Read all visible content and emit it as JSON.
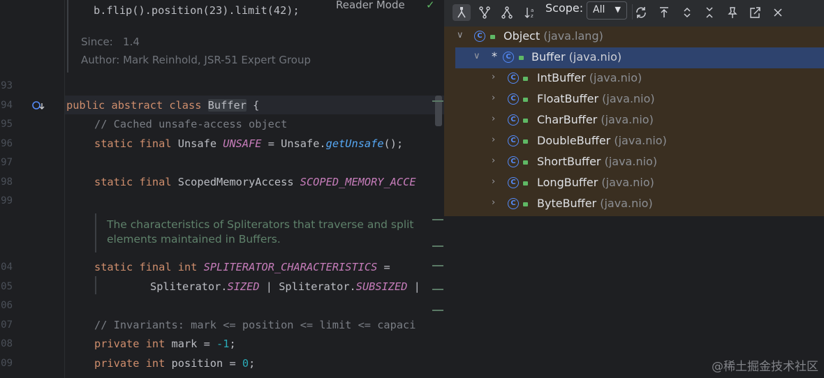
{
  "editor": {
    "top_code": "b.flip().position(23).limit(42);",
    "reader_mode": "Reader Mode",
    "doc_since_label": "Since:",
    "doc_since_value": "1.4",
    "doc_author_label": "Author:",
    "doc_author_value": "Mark Reinhold, JSR-51 Expert Group",
    "line_numbers": [
      "93",
      "94",
      "95",
      "96",
      "97",
      "98",
      "99",
      "04",
      "05",
      "06",
      "07",
      "08",
      "09"
    ],
    "class_decl": {
      "kw1": "public",
      "kw2": "abstract",
      "kw3": "class",
      "name": "Buffer",
      "brace": "{"
    },
    "comment_unsafe": "// Cached unsafe-access object",
    "unsafe_line": {
      "kw1": "static",
      "kw2": "final",
      "type": "Unsafe",
      "field": "UNSAFE",
      "eq": "=",
      "call_recv": "Unsafe.",
      "call_method": "getUnsafe",
      "call_end": "();"
    },
    "scoped_line": {
      "kw1": "static",
      "kw2": "final",
      "type": "ScopedMemoryAccess",
      "field": "SCOPED_MEMORY_ACCE"
    },
    "docblock": [
      "The characteristics of Spliterators that traverse and split",
      "elements maintained in Buffers."
    ],
    "spliterator_line": {
      "kw1": "static",
      "kw2": "final",
      "kw3": "int",
      "field": "SPLITERATOR_CHARACTERISTICS",
      "eq": "="
    },
    "spliterator_cont": {
      "p1": "Spliterator.",
      "f1": "SIZED",
      "sep": " | ",
      "p2": "Spliterator.",
      "f2": "SUBSIZED",
      "tail": " |"
    },
    "comment_invariants": "// Invariants: mark <= position <= limit <= capaci",
    "mark_line": {
      "kw1": "private",
      "kw2": "int",
      "name": "mark",
      "eq": "=",
      "val": "-1",
      "end": ";"
    },
    "position_line": {
      "kw1": "private",
      "kw2": "int",
      "name": "position",
      "eq": "=",
      "val": "0",
      "end": ";"
    }
  },
  "hierarchy": {
    "scope_label": "Scope:",
    "scope_value": "All",
    "toolbar_icons": [
      "subtypes-hierarchy-icon",
      "supertypes-hierarchy-icon",
      "class-hierarchy-icon",
      "sort-alpha-icon",
      "refresh-icon",
      "scroll-to-top-icon",
      "expand-all-icon",
      "collapse-all-icon",
      "pin-icon",
      "open-in-window-icon",
      "close-icon"
    ],
    "tree": [
      {
        "name": "Object",
        "pkg": "(java.lang)",
        "level": 0,
        "expanded": true
      },
      {
        "name": "Buffer",
        "pkg": "(java.nio)",
        "level": 1,
        "expanded": true,
        "selected": true,
        "star": "*"
      },
      {
        "name": "IntBuffer",
        "pkg": "(java.nio)",
        "level": 2
      },
      {
        "name": "FloatBuffer",
        "pkg": "(java.nio)",
        "level": 2
      },
      {
        "name": "CharBuffer",
        "pkg": "(java.nio)",
        "level": 2
      },
      {
        "name": "DoubleBuffer",
        "pkg": "(java.nio)",
        "level": 2
      },
      {
        "name": "ShortBuffer",
        "pkg": "(java.nio)",
        "level": 2
      },
      {
        "name": "LongBuffer",
        "pkg": "(java.nio)",
        "level": 2
      },
      {
        "name": "ByteBuffer",
        "pkg": "(java.nio)",
        "level": 2
      }
    ]
  },
  "watermark": "@稀土掘金技术社区",
  "colors": {
    "keyword": "#cf8e6d",
    "static_field": "#c77dbb",
    "number": "#2aacb8",
    "selection": "#2e436e",
    "tree_bg": "#3a2f21"
  }
}
